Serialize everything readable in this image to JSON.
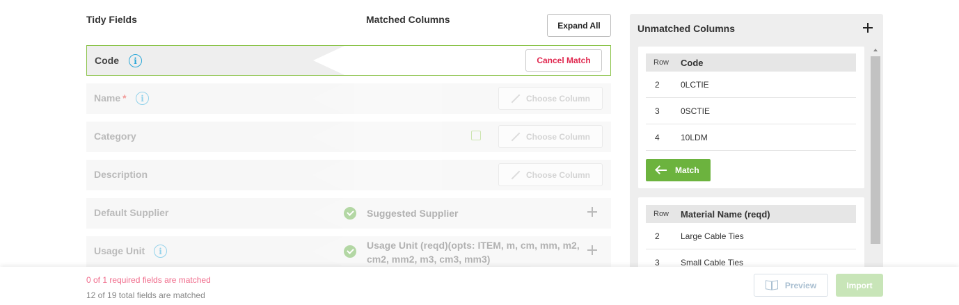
{
  "header": {
    "tidy_fields": "Tidy Fields",
    "matched_columns": "Matched Columns",
    "expand_all": "Expand All"
  },
  "fields": [
    {
      "label": "Code",
      "required": false,
      "has_info": true,
      "state": "matched",
      "action": "Cancel Match"
    },
    {
      "label": "Name",
      "required": true,
      "required_mark": "*",
      "has_info": true,
      "state": "unmatched",
      "action": "Choose Column"
    },
    {
      "label": "Category",
      "required": false,
      "has_info": false,
      "state": "unmatched",
      "action": "Choose Column"
    },
    {
      "label": "Description",
      "required": false,
      "has_info": false,
      "state": "unmatched",
      "action": "Choose Column"
    },
    {
      "label": "Default Supplier",
      "required": false,
      "has_info": false,
      "state": "suggested",
      "suggestion": "Suggested Supplier"
    },
    {
      "label": "Usage Unit",
      "required": false,
      "has_info": true,
      "state": "suggested",
      "suggestion": "Usage Unit (reqd)(opts: ITEM, m, cm, mm, m2, cm2, mm2, m3, cm3, mm3)"
    }
  ],
  "unmatched": {
    "title": "Unmatched Columns",
    "cards": [
      {
        "col_row_header": "Row",
        "col_name": "Code",
        "rows": [
          {
            "row": "2",
            "value": "0LCTIE"
          },
          {
            "row": "3",
            "value": "0SCTIE"
          },
          {
            "row": "4",
            "value": "10LDM"
          }
        ],
        "match_label": "Match"
      },
      {
        "col_row_header": "Row",
        "col_name": "Material Name (reqd)",
        "rows": [
          {
            "row": "2",
            "value": "Large Cable Ties"
          },
          {
            "row": "3",
            "value": "Small Cable Ties"
          }
        ]
      }
    ]
  },
  "footer": {
    "required_status": "0 of 1 required fields are matched",
    "total_status": "12 of 19 total fields are matched",
    "preview": "Preview",
    "import": "Import"
  },
  "colors": {
    "accent_green": "#6cb33e",
    "cancel_red": "#e0284f",
    "info_blue": "#29a7d8",
    "warning_pink": "#f06a8a"
  },
  "icons": [
    "info-icon",
    "pencil-icon",
    "check-circle-icon",
    "plus-icon",
    "arrow-left-icon",
    "book-icon"
  ]
}
